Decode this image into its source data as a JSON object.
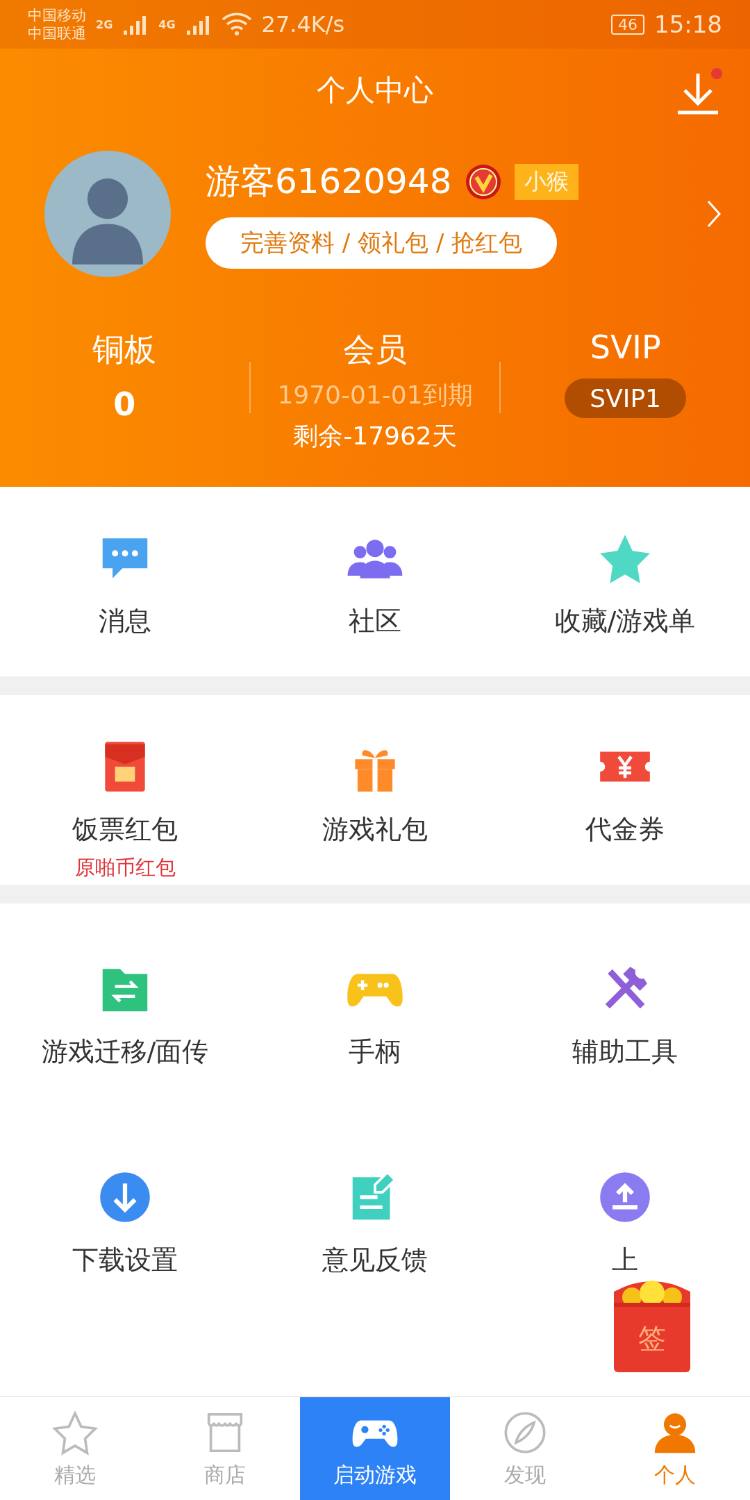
{
  "status_bar": {
    "carriers": [
      "中国移动",
      "中国联通"
    ],
    "networks": [
      "2G",
      "4G"
    ],
    "speed": "27.4K/s",
    "battery": "46",
    "time": "15:18"
  },
  "header": {
    "title": "个人中心",
    "download_badge": true
  },
  "profile": {
    "name": "游客61620948",
    "verified": true,
    "tag": "小猴",
    "action": "完善资料 / 领礼包 / 抢红包"
  },
  "stats": [
    {
      "label": "铜板",
      "kind": "value",
      "value": "0"
    },
    {
      "label": "会员",
      "kind": "member",
      "expiry": "1970-01-01到期",
      "remaining": "剩余-17962天"
    },
    {
      "label": "SVIP",
      "kind": "badge",
      "value": "SVIP1"
    }
  ],
  "sections": [
    {
      "rows": [
        [
          {
            "label": "消息",
            "kind": "chat"
          },
          {
            "label": "社区",
            "kind": "people"
          },
          {
            "label": "收藏/游戏单",
            "kind": "star"
          }
        ]
      ]
    },
    {
      "rows": [
        [
          {
            "label": "饭票红包",
            "kind": "envelope",
            "sublabel": "原啪币红包"
          },
          {
            "label": "游戏礼包",
            "kind": "gift"
          },
          {
            "label": "代金券",
            "kind": "ticket"
          }
        ]
      ]
    },
    {
      "rows": [
        [
          {
            "label": "游戏迁移/面传",
            "kind": "folder"
          },
          {
            "label": "手柄",
            "kind": "gamepad"
          },
          {
            "label": "辅助工具",
            "kind": "tools"
          }
        ],
        [
          {
            "label": "下载设置",
            "kind": "download"
          },
          {
            "label": "意见反馈",
            "kind": "note"
          },
          {
            "label": "上",
            "kind": "upload"
          }
        ]
      ]
    }
  ],
  "floating": {
    "label": "签"
  },
  "nav": [
    {
      "label": "精选",
      "kind": "star",
      "selected": false
    },
    {
      "label": "商店",
      "kind": "shop",
      "selected": false
    },
    {
      "label": "启动游戏",
      "kind": "launch",
      "selected": false
    },
    {
      "label": "发现",
      "kind": "compass",
      "selected": false
    },
    {
      "label": "个人",
      "kind": "person",
      "selected": true
    }
  ]
}
